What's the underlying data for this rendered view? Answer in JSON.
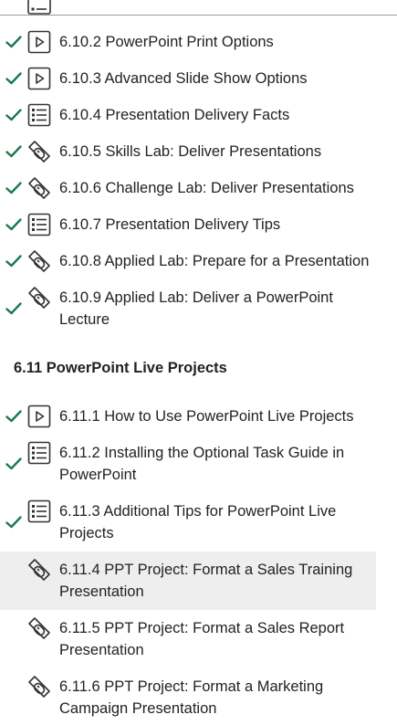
{
  "colors": {
    "check": "#1a7a4c",
    "icon": "#333333",
    "active_row": "#eeeeee"
  },
  "sections": [
    {
      "title": "",
      "items": [
        {
          "label": "6.10.2 PowerPoint Print Options",
          "icon": "video-icon",
          "completed": true
        },
        {
          "label": "6.10.3 Advanced Slide Show Options",
          "icon": "video-icon",
          "completed": true
        },
        {
          "label": "6.10.4 Presentation Delivery Facts",
          "icon": "text-list-icon",
          "completed": true
        },
        {
          "label": "6.10.5 Skills Lab: Deliver Presentations",
          "icon": "lab-mouse-icon",
          "completed": true
        },
        {
          "label": "6.10.6 Challenge Lab: Deliver Presentations",
          "icon": "lab-mouse-icon",
          "completed": true
        },
        {
          "label": "6.10.7 Presentation Delivery Tips",
          "icon": "text-list-icon",
          "completed": true
        },
        {
          "label": "6.10.8 Applied Lab: Prepare for a Presentation",
          "icon": "lab-mouse-icon",
          "completed": true
        },
        {
          "label": "6.10.9 Applied Lab: Deliver a PowerPoint Lecture",
          "icon": "lab-mouse-icon",
          "completed": true
        }
      ]
    },
    {
      "title": "6.11 PowerPoint Live Projects",
      "items": [
        {
          "label": "6.11.1 How to Use PowerPoint Live Projects",
          "icon": "video-icon",
          "completed": true
        },
        {
          "label": "6.11.2 Installing the Optional Task Guide in PowerPoint",
          "icon": "text-list-icon",
          "completed": true
        },
        {
          "label": "6.11.3 Additional Tips for PowerPoint Live Projects",
          "icon": "text-list-icon",
          "completed": true
        },
        {
          "label": "6.11.4 PPT Project: Format a Sales Training Presentation",
          "icon": "lab-mouse-icon",
          "completed": false,
          "active": true
        },
        {
          "label": "6.11.5 PPT Project: Format a Sales Report Presentation",
          "icon": "lab-mouse-icon",
          "completed": false
        },
        {
          "label": "6.11.6 PPT Project: Format a Marketing Campaign Presentation",
          "icon": "lab-mouse-icon",
          "completed": false
        }
      ]
    }
  ]
}
